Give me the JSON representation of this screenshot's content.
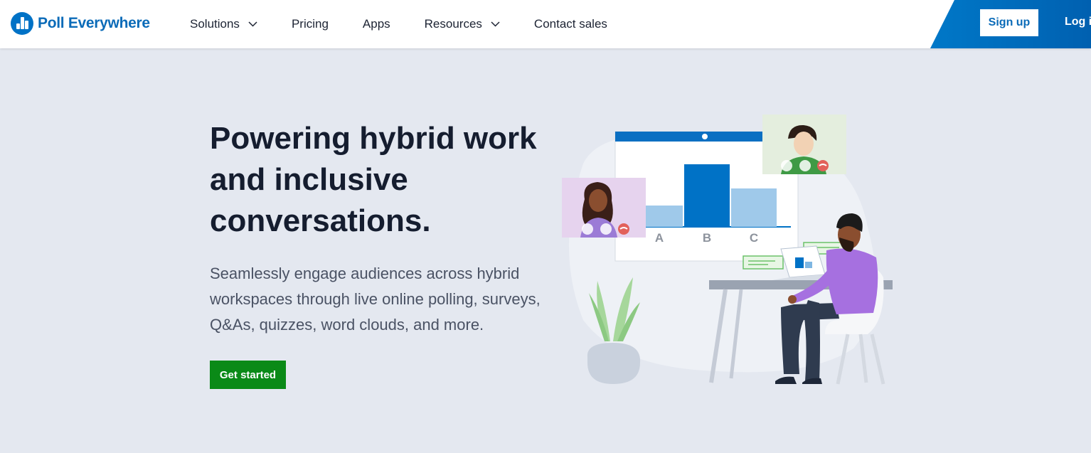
{
  "brand": {
    "name": "Poll Everywhere",
    "color": "#0072c6"
  },
  "nav": {
    "items": [
      {
        "label": "Solutions",
        "dropdown": true
      },
      {
        "label": "Pricing",
        "dropdown": false
      },
      {
        "label": "Apps",
        "dropdown": false
      },
      {
        "label": "Resources",
        "dropdown": true
      },
      {
        "label": "Contact sales",
        "dropdown": false
      }
    ],
    "signup_label": "Sign up",
    "login_label": "Log in"
  },
  "hero": {
    "title": "Powering hybrid work and inclusive conversations.",
    "subtitle": "Seamlessly engage audiences across hybrid workspaces through live online polling, surveys, Q&As, quizzes, word clouds, and more.",
    "cta_label": "Get started"
  },
  "illustration": {
    "chart_labels": [
      "A",
      "B",
      "C"
    ],
    "chart_levels": [
      0.3,
      0.88,
      0.54
    ],
    "accent_color": "#0072c6",
    "cta_color": "#0a8a17"
  }
}
